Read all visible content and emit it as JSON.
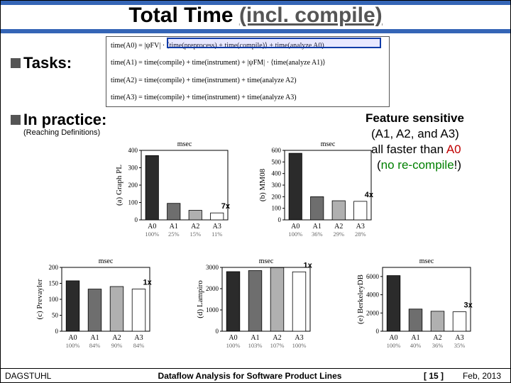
{
  "title": {
    "main": "Total Time",
    "paren": "(incl. compile)"
  },
  "bullets": {
    "tasks": "Tasks:",
    "practice": "In practice:",
    "sub": "(Reaching Definitions)"
  },
  "formulas": {
    "a0": "time(A0) = |ψFV| · ⟨time(preprocess) + time(compile)⟩ + time(analyze A0)",
    "a1": "time(A1) = time(compile) + time(instrument) + |ψFM| · ⟨time(analyze A1)⟩",
    "a2": "time(A2) = time(compile) + time(instrument) + time(analyze A2)",
    "a3": "time(A3) = time(compile) + time(instrument) + time(analyze A3)"
  },
  "feature": {
    "l1a": "Feature sensitive",
    "l2": "(A1, A2, and A3)",
    "l3a": "all faster than ",
    "l3b": "A0",
    "l4a": "(",
    "l4b": "no re-compile",
    "l4c": "!)"
  },
  "chart_data": [
    {
      "type": "bar",
      "panel": "(a) Graph PL",
      "ylabel": "msec",
      "categories": [
        "A0",
        "A1",
        "A2",
        "A3"
      ],
      "values": [
        370,
        95,
        55,
        40
      ],
      "pct": [
        "100%",
        "25%",
        "15%",
        "11%"
      ],
      "ylim": [
        0,
        400
      ],
      "ticks": [
        0,
        100,
        200,
        300,
        400
      ],
      "speedup": "7x"
    },
    {
      "type": "bar",
      "panel": "(b) MM08",
      "ylabel": "msec",
      "categories": [
        "A0",
        "A1",
        "A2",
        "A3"
      ],
      "values": [
        575,
        200,
        165,
        160
      ],
      "pct": [
        "100%",
        "36%",
        "29%",
        "28%"
      ],
      "ylim": [
        0,
        600
      ],
      "ticks": [
        0,
        100,
        200,
        300,
        400,
        500,
        600
      ],
      "speedup": "4x"
    },
    {
      "type": "bar",
      "panel": "(c) Prevayler",
      "ylabel": "msec",
      "categories": [
        "A0",
        "A1",
        "A2",
        "A3"
      ],
      "values": [
        158,
        132,
        140,
        132
      ],
      "pct": [
        "100%",
        "84%",
        "90%",
        "84%"
      ],
      "ylim": [
        0,
        200
      ],
      "ticks": [
        0,
        50,
        100,
        150,
        200
      ],
      "speedup": "1x"
    },
    {
      "type": "bar",
      "panel": "(d) Lampiro",
      "ylabel": "msec",
      "categories": [
        "A0",
        "A1",
        "A2",
        "A3"
      ],
      "values": [
        2800,
        2850,
        2990,
        2790
      ],
      "pct": [
        "100%",
        "103%",
        "107%",
        "100%"
      ],
      "ylim": [
        0,
        3000
      ],
      "ticks": [
        0,
        1000,
        2000,
        3000
      ],
      "speedup": "1x"
    },
    {
      "type": "bar",
      "panel": "(e) BerkeleyDB",
      "ylabel": "msec",
      "categories": [
        "A0",
        "A1",
        "A2",
        "A3"
      ],
      "values": [
        6100,
        2430,
        2190,
        2130
      ],
      "pct": [
        "100%",
        "40%",
        "36%",
        "35%"
      ],
      "ylim": [
        0,
        7000
      ],
      "ticks": [
        0,
        2000,
        4000,
        6000
      ],
      "speedup": "3x"
    }
  ],
  "footer": {
    "left": "DAGSTUHL",
    "center": "Dataflow Analysis for Software Product Lines",
    "page": "[ 15 ]",
    "date": "Feb, 2013"
  }
}
